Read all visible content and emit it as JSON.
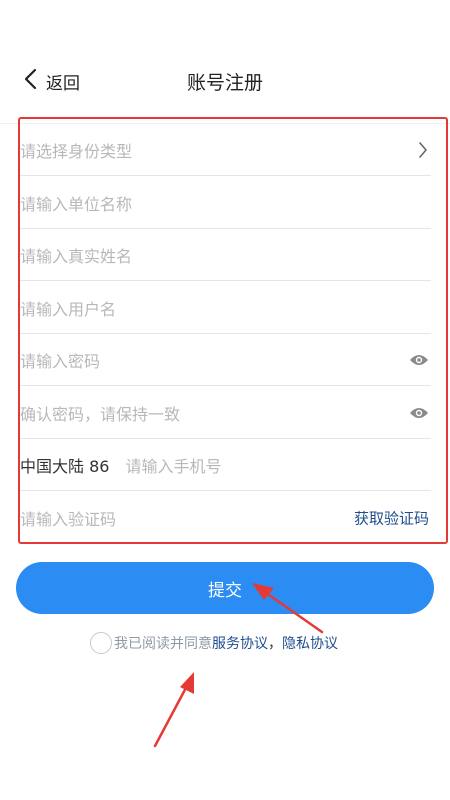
{
  "header": {
    "back_label": "返回",
    "title": "账号注册"
  },
  "form": {
    "identity_type_placeholder": "请选择身份类型",
    "unit_name_placeholder": "请输入单位名称",
    "real_name_placeholder": "请输入真实姓名",
    "username_placeholder": "请输入用户名",
    "password_placeholder": "请输入密码",
    "confirm_password_placeholder": "确认密码，请保持一致",
    "phone_prefix": "中国大陆 86",
    "phone_placeholder": "请输入手机号",
    "code_placeholder": "请输入验证码",
    "get_code_label": "获取验证码"
  },
  "submit_label": "提交",
  "agreement": {
    "text": "我已阅读并同意",
    "service_link": "服务协议",
    "separator": "，",
    "privacy_link": "隐私协议"
  },
  "colors": {
    "primary": "#2b8cf4",
    "link": "#1f4e8c",
    "annotation": "#e53935"
  },
  "icons": {
    "back": "chevron-left-icon",
    "select": "chevron-right-icon",
    "password_visibility": "eye-icon"
  }
}
